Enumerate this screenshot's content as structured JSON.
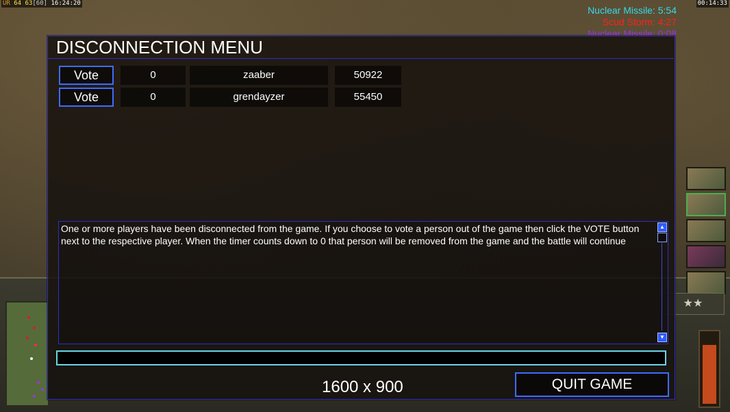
{
  "hud": {
    "ur_label": "UR",
    "fps_a": "64",
    "fps_b": "63",
    "fps_c": "[60]",
    "clock": "16:24:20",
    "game_time": "00:14:33"
  },
  "timers": [
    {
      "label": "Nuclear Missile: 5:54",
      "color": "#38d8e8"
    },
    {
      "label": "Scud Storm: 4:27",
      "color": "#ff2020"
    },
    {
      "label": "Nuclear Missile: 0:08",
      "color": "#9b35e0"
    }
  ],
  "dialog": {
    "title": "DISCONNECTION MENU",
    "players": [
      {
        "vote_label": "Vote",
        "votes": "0",
        "name": "zaaber",
        "ping": "50922"
      },
      {
        "vote_label": "Vote",
        "votes": "0",
        "name": "grendayzer",
        "ping": "55450"
      }
    ],
    "message": "One or more players have been disconnected from the game. If you choose to vote a person out of the game then click the VOTE button next to the respective player. When the timer counts down to 0 that person will be removed from the game and the battle will continue",
    "chat_value": "",
    "resolution_text": "1600 x 900",
    "quit_label": "QUIT GAME"
  },
  "colors": {
    "dialog_border": "#2f2fc8",
    "button_border": "#3f6cff",
    "chat_border": "#69d6e6"
  }
}
